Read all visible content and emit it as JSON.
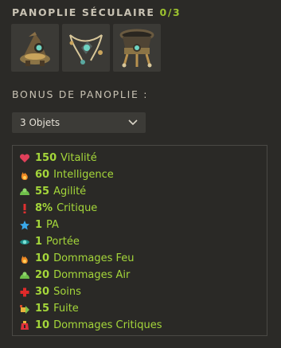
{
  "set": {
    "title": "PANOPLIE SÉCULAIRE",
    "progress": "0/3",
    "items": [
      {
        "icon": "hat-icon"
      },
      {
        "icon": "amulet-icon"
      },
      {
        "icon": "belt-icon"
      }
    ]
  },
  "bonus": {
    "section_title": "BONUS DE PANOPLIE :",
    "selected_option": "3 Objets",
    "stats": [
      {
        "value": "150",
        "label": "Vitalité",
        "icon": "heart-icon"
      },
      {
        "value": "60",
        "label": "Intelligence",
        "icon": "fire-icon"
      },
      {
        "value": "55",
        "label": "Agilité",
        "icon": "wind-icon"
      },
      {
        "value": "8%",
        "label": "Critique",
        "icon": "exclamation-icon"
      },
      {
        "value": "1",
        "label": "PA",
        "icon": "star-icon"
      },
      {
        "value": "1",
        "label": "Portée",
        "icon": "eye-icon"
      },
      {
        "value": "10",
        "label": "Dommages Feu",
        "icon": "fire-icon"
      },
      {
        "value": "20",
        "label": "Dommages Air",
        "icon": "wind-icon"
      },
      {
        "value": "30",
        "label": "Soins",
        "icon": "cross-icon"
      },
      {
        "value": "15",
        "label": "Fuite",
        "icon": "flee-icon"
      },
      {
        "value": "10",
        "label": "Dommages Critiques",
        "icon": "critical-damage-icon"
      }
    ]
  },
  "colors": {
    "accent_green": "#a4d63a",
    "progress_green": "#9cc22f",
    "background": "#2b2a27"
  }
}
